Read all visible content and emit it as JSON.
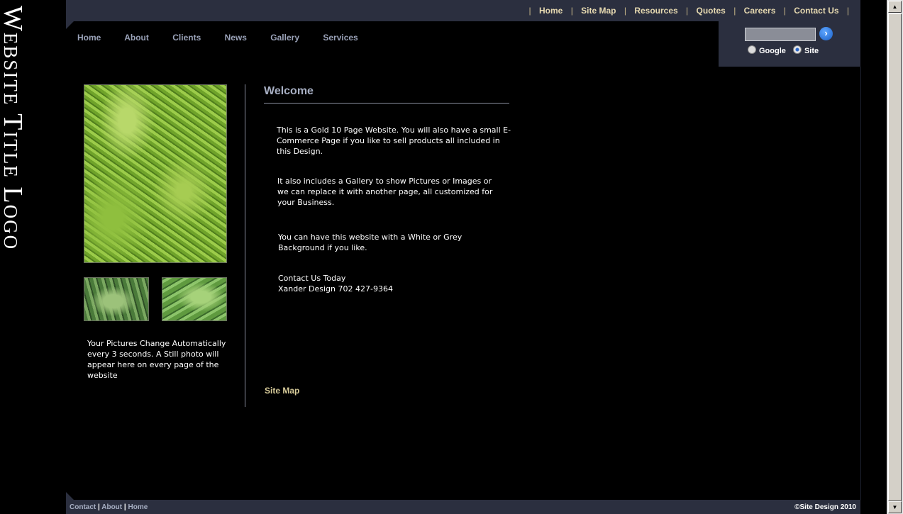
{
  "logo": {
    "text": "Website Title Logo"
  },
  "top_nav": {
    "items": [
      "Home",
      "Site Map",
      "Resources",
      "Quotes",
      "Careers",
      "Contact Us"
    ]
  },
  "search": {
    "placeholder": "",
    "go_icon": "chevron-right-icon",
    "options": [
      {
        "label": "Google",
        "selected": false
      },
      {
        "label": "Site",
        "selected": true
      }
    ]
  },
  "main_nav": {
    "items": [
      "Home",
      "About",
      "Clients",
      "News",
      "Gallery",
      "Services"
    ]
  },
  "sidebar": {
    "caption": "Your Pictures Change Automatically every 3 seconds.  A Still photo will appear here on every page of the website"
  },
  "content": {
    "title": "Welcome",
    "paragraphs": [
      "This is a Gold 10 Page Website. You will also have a small E-Commerce Page if you like to sell products all included in this Design.",
      "It also includes a Gallery to show Pictures or Images or we can replace it with another page, all customized for your Business.",
      "You can have this website with a White or Grey Background if you like."
    ],
    "contact_line1": "Contact Us Today",
    "contact_line2": "Xander Design 702 427-9364",
    "sitemap_link": "Site Map"
  },
  "footer": {
    "links": [
      "Contact",
      "About",
      "Home"
    ],
    "copyright": "©Site Design 2010"
  },
  "colors": {
    "bar": "#2b2f3f",
    "top_link": "#e6d9b0",
    "nav_link": "#9aa2b8",
    "heading": "#a7afc3"
  }
}
